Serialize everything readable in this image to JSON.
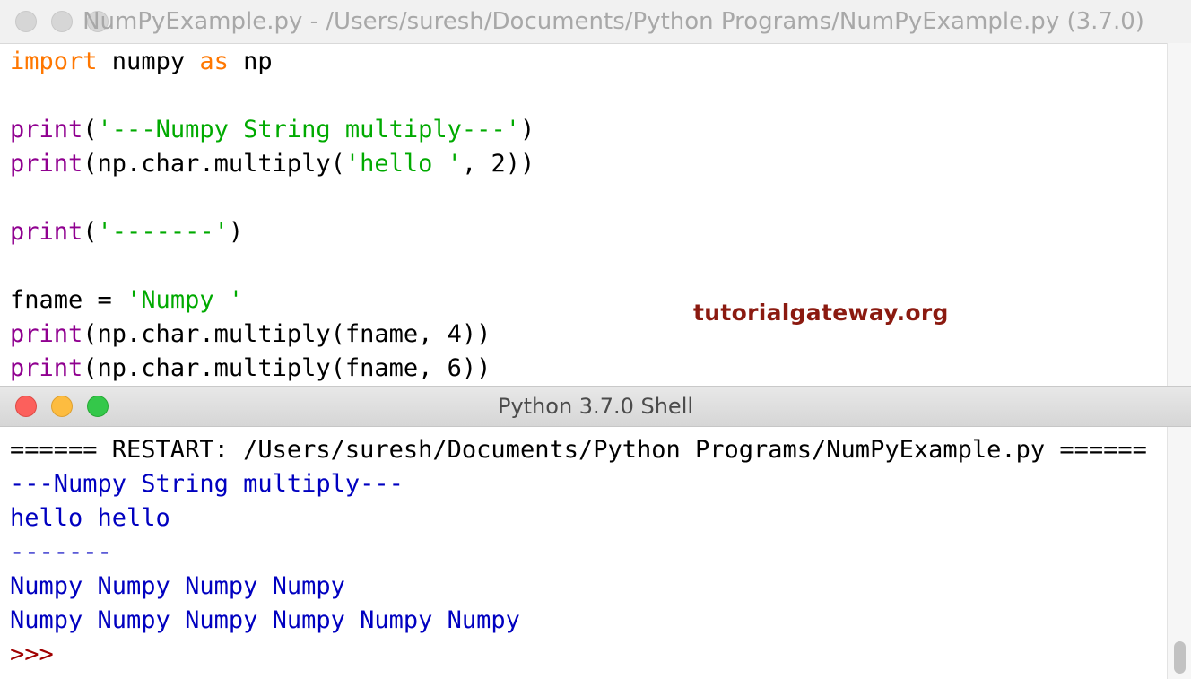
{
  "editor": {
    "title": "NumPyExample.py - /Users/suresh/Documents/Python Programs/NumPyExample.py (3.7.0)",
    "lines": [
      [
        {
          "t": "import",
          "c": "kw"
        },
        {
          "t": " numpy ",
          "c": "plain"
        },
        {
          "t": "as",
          "c": "kw"
        },
        {
          "t": " np",
          "c": "plain"
        }
      ],
      [],
      [
        {
          "t": "print",
          "c": "bi"
        },
        {
          "t": "(",
          "c": "plain"
        },
        {
          "t": "'---Numpy String multiply---'",
          "c": "str"
        },
        {
          "t": ")",
          "c": "plain"
        }
      ],
      [
        {
          "t": "print",
          "c": "bi"
        },
        {
          "t": "(np.char.multiply(",
          "c": "plain"
        },
        {
          "t": "'hello '",
          "c": "str"
        },
        {
          "t": ", 2))",
          "c": "plain"
        }
      ],
      [],
      [
        {
          "t": "print",
          "c": "bi"
        },
        {
          "t": "(",
          "c": "plain"
        },
        {
          "t": "'-------'",
          "c": "str"
        },
        {
          "t": ")",
          "c": "plain"
        }
      ],
      [],
      [
        {
          "t": "fname = ",
          "c": "plain"
        },
        {
          "t": "'Numpy '",
          "c": "str"
        }
      ],
      [
        {
          "t": "print",
          "c": "bi"
        },
        {
          "t": "(np.char.multiply(fname, 4))",
          "c": "plain"
        }
      ],
      [
        {
          "t": "print",
          "c": "bi"
        },
        {
          "t": "(np.char.multiply(fname, 6))",
          "c": "plain"
        }
      ]
    ]
  },
  "watermark": "tutorialgateway.org",
  "shell": {
    "title": "Python 3.7.0 Shell",
    "lines": [
      [
        {
          "t": "====== RESTART: /Users/suresh/Documents/Python Programs/NumPyExample.py ======",
          "c": "plain"
        }
      ],
      [
        {
          "t": "---Numpy String multiply---",
          "c": "out"
        }
      ],
      [
        {
          "t": "hello hello",
          "c": "out"
        }
      ],
      [
        {
          "t": "-------",
          "c": "out"
        }
      ],
      [
        {
          "t": "Numpy Numpy Numpy Numpy",
          "c": "out"
        }
      ],
      [
        {
          "t": "Numpy Numpy Numpy Numpy Numpy Numpy",
          "c": "out"
        }
      ],
      [
        {
          "t": ">>> ",
          "c": "prompt"
        }
      ]
    ]
  },
  "colors": {
    "keyword": "#ff7700",
    "builtin": "#900090",
    "string": "#00aa00",
    "output": "#0000c0",
    "prompt": "#a00000",
    "watermark": "#8b1a10"
  }
}
